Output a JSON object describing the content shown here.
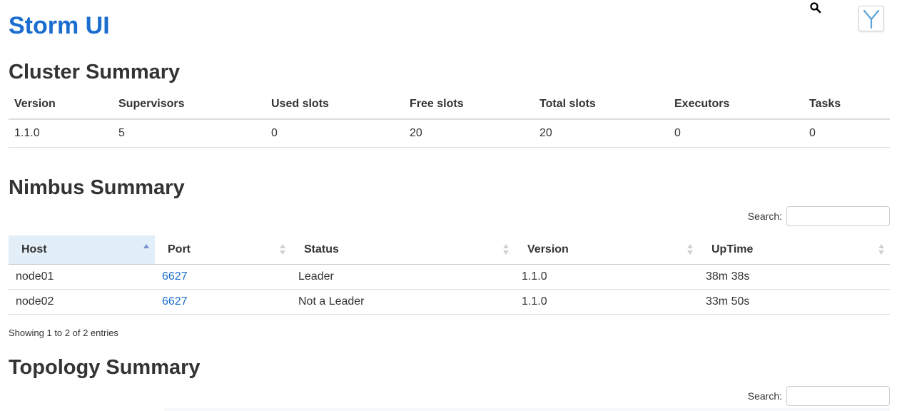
{
  "header": {
    "title": "Storm UI",
    "title_color": "#1a6ccf",
    "search_icon": "search-icon",
    "logo_icon": "storm-y-logo-icon",
    "logo_color": "#5ba3d6"
  },
  "cluster_summary": {
    "title": "Cluster Summary",
    "columns": [
      "Version",
      "Supervisors",
      "Used slots",
      "Free slots",
      "Total slots",
      "Executors",
      "Tasks"
    ],
    "rows": [
      [
        "1.1.0",
        "5",
        "0",
        "20",
        "20",
        "0",
        "0"
      ]
    ]
  },
  "nimbus_summary": {
    "title": "Nimbus Summary",
    "search": {
      "label": "Search:",
      "value": "",
      "placeholder": ""
    },
    "sorted_column": "Host",
    "sort_direction": "ascending",
    "columns": [
      "Host",
      "Port",
      "Status",
      "Version",
      "UpTime"
    ],
    "rows": [
      [
        "node01",
        "6627",
        "Leader",
        "1.1.0",
        "38m 38s"
      ],
      [
        "node02",
        "6627",
        "Not a Leader",
        "1.1.0",
        "33m 50s"
      ]
    ],
    "info": "Showing 1 to 2 of 2 entries",
    "link_color": "#1a6ccf",
    "sorted_header_color": "#e2eef8"
  },
  "topology_summary": {
    "title": "Topology Summary",
    "search": {
      "label": "Search:",
      "value": "",
      "placeholder": ""
    }
  }
}
